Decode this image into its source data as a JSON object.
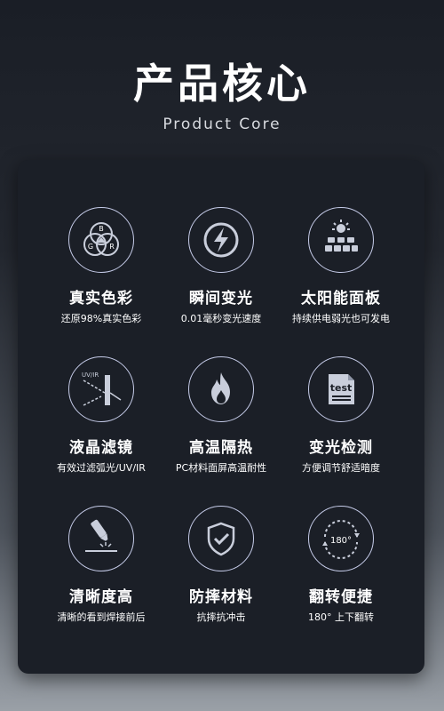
{
  "header": {
    "title": "产品核心",
    "subtitle": "Product Core"
  },
  "features": [
    {
      "icon": "rgb-color-icon",
      "title": "真实色彩",
      "desc": "还原98%真实色彩",
      "icon_letters": [
        "B",
        "G",
        "R"
      ]
    },
    {
      "icon": "lightning-icon",
      "title": "瞬间变光",
      "desc": "0.01毫秒变光速度"
    },
    {
      "icon": "solar-panel-icon",
      "title": "太阳能面板",
      "desc": "持续供电弱光也可发电"
    },
    {
      "icon": "uv-ir-filter-icon",
      "title": "液晶滤镜",
      "desc": "有效过滤弧光/UV/IR",
      "icon_text": "UV/IR"
    },
    {
      "icon": "flame-icon",
      "title": "高温隔热",
      "desc": "PC材料面屏高温耐性"
    },
    {
      "icon": "test-document-icon",
      "title": "变光检测",
      "desc": "方便调节舒适暗度",
      "icon_text": "test"
    },
    {
      "icon": "welding-torch-icon",
      "title": "清晰度高",
      "desc": "清晰的看到焊接前后"
    },
    {
      "icon": "shield-check-icon",
      "title": "防摔材料",
      "desc": "抗摔抗冲击"
    },
    {
      "icon": "rotate-180-icon",
      "title": "翻转便捷",
      "desc": "180° 上下翻转",
      "icon_text": "180°"
    }
  ],
  "colors": {
    "card_bg": "#1b1f27",
    "icon_stroke": "#c5cbe8",
    "icon_fill": "#c9cedb",
    "text": "#ffffff"
  }
}
